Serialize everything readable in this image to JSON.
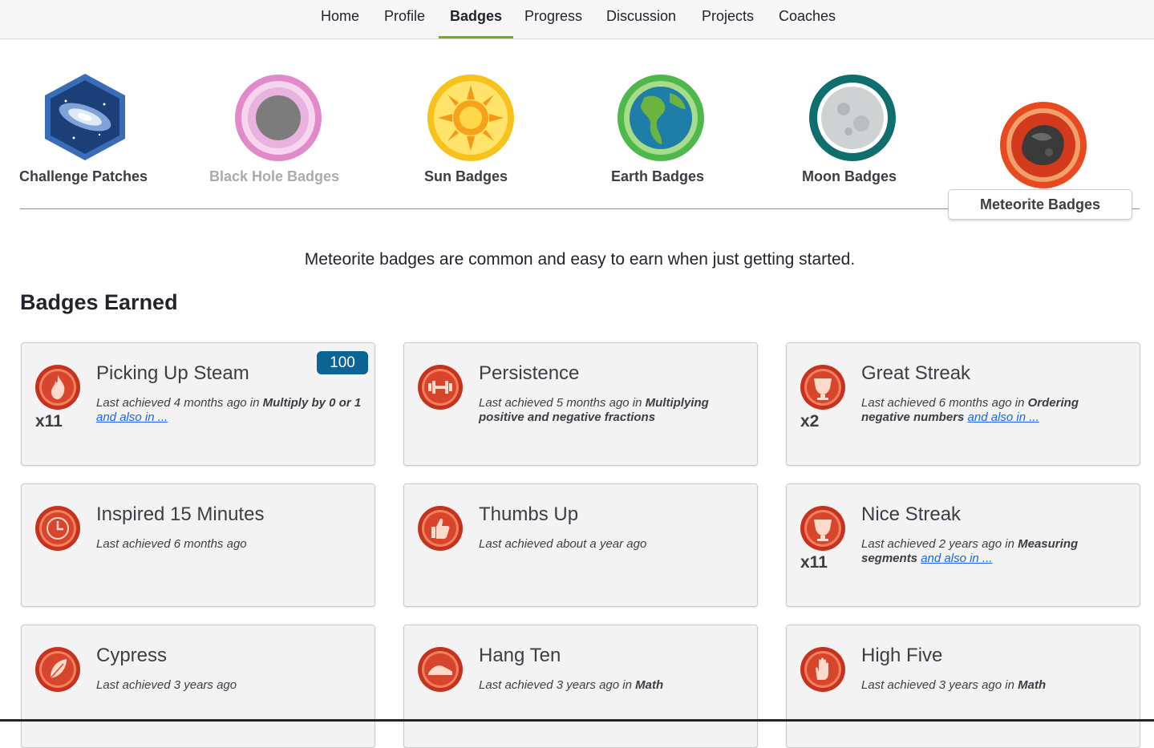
{
  "nav": {
    "items": [
      {
        "label": "Home"
      },
      {
        "label": "Profile"
      },
      {
        "label": "Badges"
      },
      {
        "label": "Progress"
      },
      {
        "label": "Discussion"
      },
      {
        "label": "Projects"
      },
      {
        "label": "Coaches"
      }
    ],
    "active": "Badges",
    "accent_color": "#71b307"
  },
  "categories": [
    {
      "label": "Challenge Patches",
      "icon": "galaxy-hexagon-icon"
    },
    {
      "label": "Black Hole Badges",
      "icon": "black-hole-icon"
    },
    {
      "label": "Sun Badges",
      "icon": "sun-icon"
    },
    {
      "label": "Earth Badges",
      "icon": "earth-icon"
    },
    {
      "label": "Moon Badges",
      "icon": "moon-icon"
    },
    {
      "label": "Meteorite Badges",
      "icon": "meteorite-icon"
    }
  ],
  "selected_category": "Meteorite Badges",
  "description": "Meteorite badges are common and easy to earn when just getting started.",
  "section_title": "Badges Earned",
  "badges": [
    {
      "title": "Picking Up Steam",
      "count": "x11",
      "points": "100",
      "icon": "flame-icon",
      "pre": "Last achieved 4 months ago in ",
      "bold": "Multiply by 0 or 1",
      "link": "and also in ..."
    },
    {
      "title": "Persistence",
      "count": "",
      "points": "",
      "icon": "dumbbell-icon",
      "pre": "Last achieved 5 months ago in ",
      "bold": "Multiplying positive and negative fractions",
      "link": ""
    },
    {
      "title": "Great Streak",
      "count": "x2",
      "points": "",
      "icon": "trophy-40-icon",
      "pre": "Last achieved 6 months ago in ",
      "bold": "Ordering negative numbers",
      "link": "and also in ..."
    },
    {
      "title": "Inspired 15 Minutes",
      "count": "",
      "points": "",
      "icon": "clock-icon",
      "pre": "Last achieved 6 months ago",
      "bold": "",
      "link": ""
    },
    {
      "title": "Thumbs Up",
      "count": "",
      "points": "",
      "icon": "thumbs-up-icon",
      "pre": "Last achieved about a year ago",
      "bold": "",
      "link": ""
    },
    {
      "title": "Nice Streak",
      "count": "x11",
      "points": "",
      "icon": "trophy-20-icon",
      "pre": "Last achieved 2 years ago in ",
      "bold": "Measuring segments",
      "link": "and also in ..."
    },
    {
      "title": "Cypress",
      "count": "",
      "points": "",
      "icon": "leaf-icon",
      "pre": "Last achieved 3 years ago",
      "bold": "",
      "link": ""
    },
    {
      "title": "Hang Ten",
      "count": "",
      "points": "",
      "icon": "wave-icon",
      "pre": "Last achieved 3 years ago in ",
      "bold": "Math",
      "link": ""
    },
    {
      "title": "High Five",
      "count": "",
      "points": "",
      "icon": "hand-icon",
      "pre": "Last achieved 3 years ago in ",
      "bold": "Math",
      "link": ""
    }
  ],
  "colors": {
    "badge_red": "#d8452d",
    "points_blue": "#0b6493",
    "link_blue": "#1865f2"
  }
}
